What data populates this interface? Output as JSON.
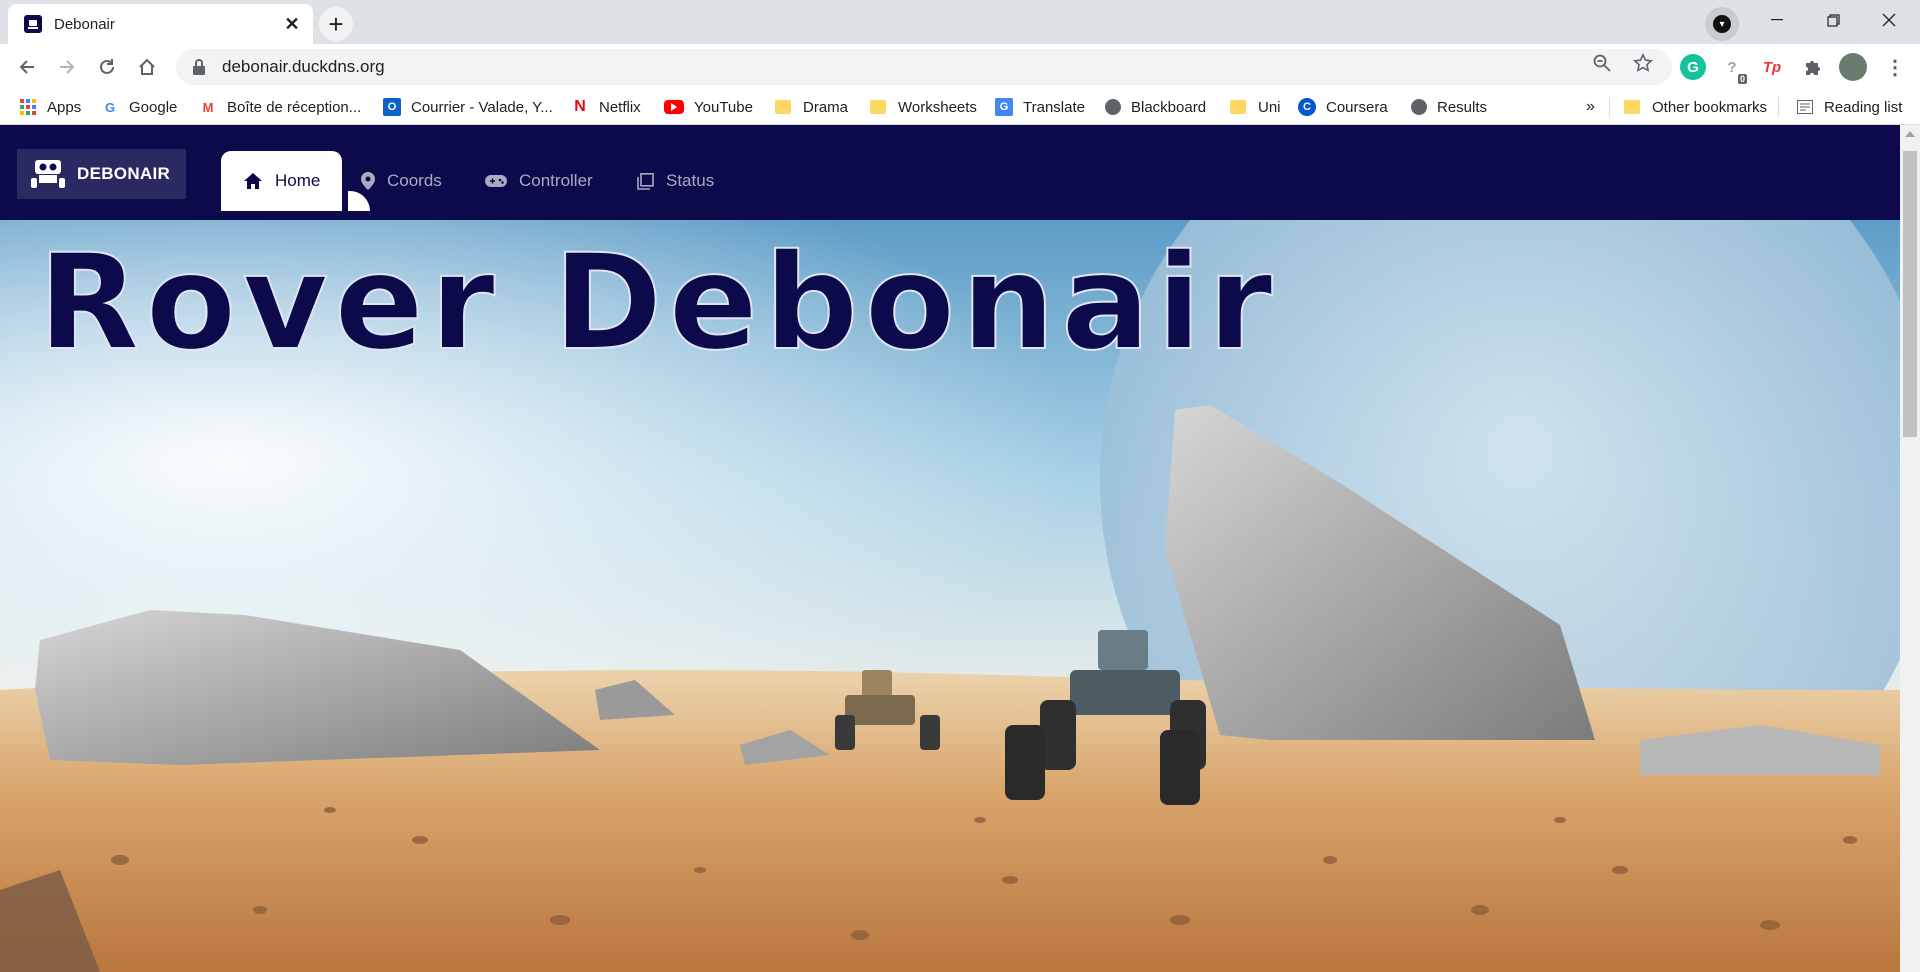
{
  "browser": {
    "tab_title": "Debonair",
    "url": "debonair.duckdns.org",
    "new_tab_label": "+",
    "tab_close_label": "✕"
  },
  "bookmarks": {
    "items": [
      {
        "label": "Apps",
        "icon": "apps-grid-icon"
      },
      {
        "label": "Google",
        "icon": "google-icon"
      },
      {
        "label": "Boîte de réception...",
        "icon": "gmail-icon"
      },
      {
        "label": "Courrier - Valade, Y...",
        "icon": "outlook-icon"
      },
      {
        "label": "Netflix",
        "icon": "netflix-icon"
      },
      {
        "label": "YouTube",
        "icon": "youtube-icon"
      },
      {
        "label": "Drama",
        "icon": "folder-icon"
      },
      {
        "label": "Worksheets",
        "icon": "folder-icon"
      },
      {
        "label": "Translate",
        "icon": "translate-icon"
      },
      {
        "label": "Blackboard",
        "icon": "globe-icon"
      },
      {
        "label": "Uni",
        "icon": "folder-icon"
      },
      {
        "label": "Coursera",
        "icon": "coursera-icon"
      },
      {
        "label": "Results",
        "icon": "globe-icon"
      }
    ],
    "overflow": "»",
    "other": "Other bookmarks",
    "reading_list": "Reading list"
  },
  "site": {
    "brand": "DEBONAIR",
    "nav": [
      {
        "label": "Home",
        "icon": "home-icon",
        "active": true
      },
      {
        "label": "Coords",
        "icon": "map-pin-icon",
        "active": false
      },
      {
        "label": "Controller",
        "icon": "gamepad-icon",
        "active": false
      },
      {
        "label": "Status",
        "icon": "status-icon",
        "active": false
      }
    ],
    "hero_title": "Rover Debonair"
  },
  "colors": {
    "nav_bg": "#0c0a4a",
    "title_color": "#0c0a4a"
  },
  "extensions": {
    "badge_count": "0"
  }
}
